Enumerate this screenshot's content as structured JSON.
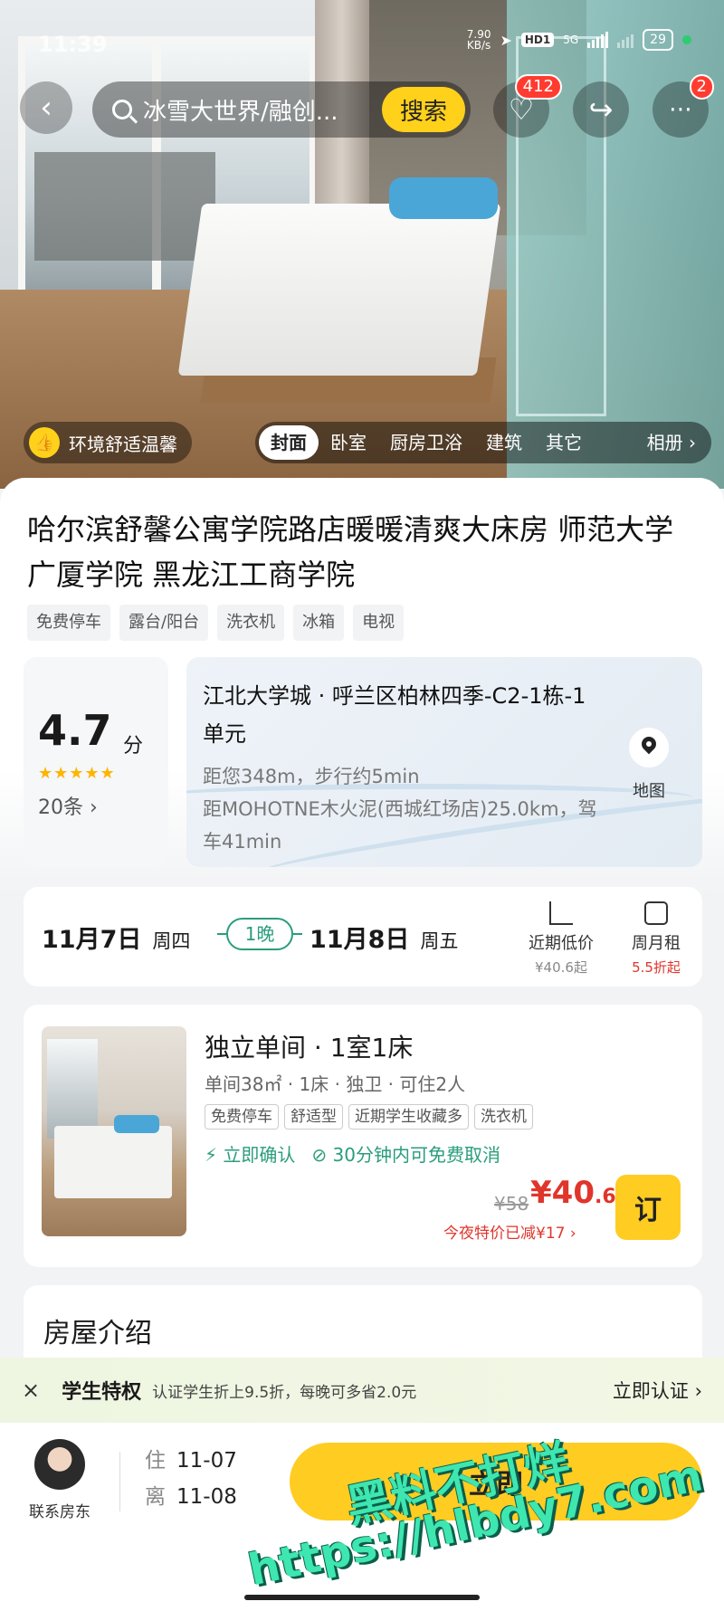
{
  "status_bar": {
    "time": "11:39",
    "net_speed_value": "7.90",
    "net_speed_unit": "KB/s",
    "hd_label": "HD1",
    "network": "5G",
    "battery": "29"
  },
  "nav": {
    "search_text": "冰雪大世界/融创...",
    "search_button": "搜索",
    "favorites_count": "412",
    "messages_count": "2"
  },
  "hero": {
    "env_tag": "环境舒适温馨",
    "photo_tabs": [
      "封面",
      "卧室",
      "厨房卫浴",
      "建筑",
      "其它"
    ],
    "album_label": "相册 ›"
  },
  "listing": {
    "title": "哈尔滨舒馨公寓学院路店暖暖清爽大床房 师范大学 广厦学院 黑龙江工商学院",
    "amenities": [
      "免费停车",
      "露台/阳台",
      "洗衣机",
      "冰箱",
      "电视"
    ]
  },
  "rating": {
    "score": "4.7",
    "unit": "分",
    "stars": "★★★★★",
    "reviews": "20条 ›"
  },
  "location": {
    "address": "江北大学城 · 呼兰区柏林四季-C2-1栋-1单元",
    "distance_walk": "距您348m，步行约5min",
    "distance_drive": "距MOHOTNE木火泥(西城红场店)25.0km，驾车41min",
    "map_label": "地图"
  },
  "dates": {
    "checkin": "11月7日",
    "checkin_week": "周四",
    "nights": "1晚",
    "checkout": "11月8日",
    "checkout_week": "周五",
    "low_price_label": "近期低价",
    "low_price_sub": "¥40.6起",
    "monthly_label": "周月租",
    "monthly_sub": "5.5折起"
  },
  "room": {
    "name": "独立单间 · 1室1床",
    "spec": "单间38㎡ · 1床 · 独卫 · 可住2人",
    "tags": [
      "免费停车",
      "舒适型",
      "近期学生收藏多",
      "洗衣机"
    ],
    "confirm": "⚡ 立即确认",
    "cancel": "⊘ 30分钟内可免费取消",
    "original_price": "¥58",
    "price_main": "¥40",
    "price_decimal": ".6",
    "discount": "今夜特价已减¥17 ›",
    "book_button": "订"
  },
  "intro": {
    "title": "房屋介绍"
  },
  "student": {
    "close": "×",
    "title": "学生特权",
    "desc": "认证学生折上9.5折，每晚可多省2.0元",
    "action": "立即认证 ›"
  },
  "bottom": {
    "host_label": "联系房东",
    "checkin_key": "住",
    "checkin_value": "11-07",
    "checkout_key": "离",
    "checkout_value": "11-08",
    "reserve_button": "立即"
  },
  "watermark": {
    "line1": "黑料不打烊",
    "line2": "https://hlbdy7.com"
  },
  "colors": {
    "accent_yellow": "#ffcc22",
    "price_red": "#e0352b",
    "green": "#2a9d7c"
  }
}
